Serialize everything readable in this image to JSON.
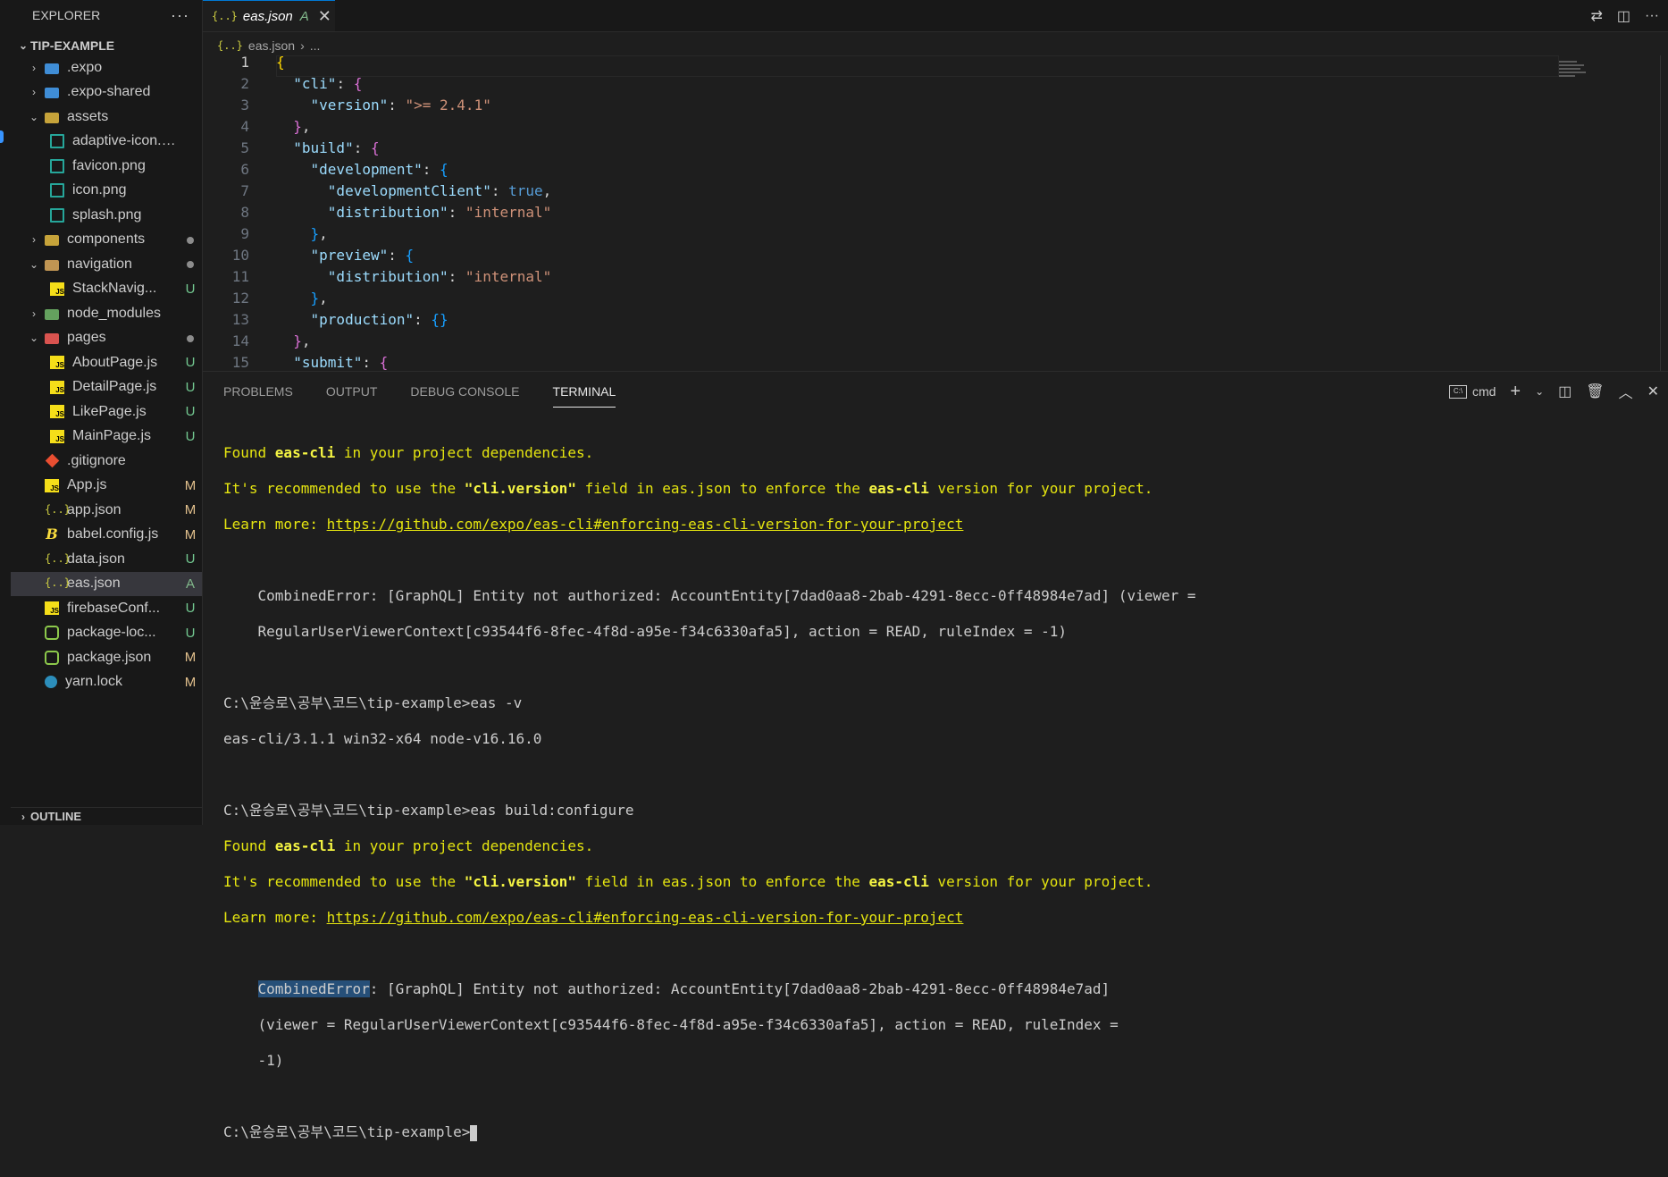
{
  "explorer": {
    "title": "EXPLORER",
    "more": "···",
    "project": "TIP-EXAMPLE",
    "items": [
      {
        "name": ".expo",
        "chev": "›",
        "icon": "folder-expo-icon",
        "badge": ""
      },
      {
        "name": ".expo-shared",
        "chev": "›",
        "icon": "folder-expo-icon",
        "badge": ""
      },
      {
        "name": "assets",
        "chev": "⌄",
        "icon": "folder-assets-icon",
        "badge": ""
      },
      {
        "name": "adaptive-icon.png",
        "icon": "image-file-icon",
        "badge": ""
      },
      {
        "name": "favicon.png",
        "icon": "image-file-icon",
        "badge": ""
      },
      {
        "name": "icon.png",
        "icon": "image-file-icon",
        "badge": ""
      },
      {
        "name": "splash.png",
        "icon": "image-file-icon",
        "badge": ""
      },
      {
        "name": "components",
        "chev": "›",
        "icon": "folder-components-icon",
        "badge": "dot"
      },
      {
        "name": "navigation",
        "chev": "⌄",
        "icon": "folder-icon",
        "badge": "dot"
      },
      {
        "name": "StackNavig...",
        "icon": "js-file-icon",
        "badge": "U"
      },
      {
        "name": "node_modules",
        "chev": "›",
        "icon": "folder-node-icon",
        "badge": ""
      },
      {
        "name": "pages",
        "chev": "⌄",
        "icon": "folder-pages-icon",
        "badge": "dot"
      },
      {
        "name": "AboutPage.js",
        "icon": "js-file-icon",
        "badge": "U"
      },
      {
        "name": "DetailPage.js",
        "icon": "js-file-icon",
        "badge": "U"
      },
      {
        "name": "LikePage.js",
        "icon": "js-file-icon",
        "badge": "U"
      },
      {
        "name": "MainPage.js",
        "icon": "js-file-icon",
        "badge": "U"
      },
      {
        "name": ".gitignore",
        "icon": "git-file-icon",
        "badge": ""
      },
      {
        "name": "App.js",
        "icon": "js-file-icon",
        "badge": "M"
      },
      {
        "name": "app.json",
        "icon": "json-file-icon",
        "badge": "M"
      },
      {
        "name": "babel.config.js",
        "icon": "babel-file-icon",
        "badge": "M"
      },
      {
        "name": "data.json",
        "icon": "json-file-icon",
        "badge": "U"
      },
      {
        "name": "eas.json",
        "icon": "json-file-icon",
        "badge": "A"
      },
      {
        "name": "firebaseConf...",
        "icon": "js-file-icon",
        "badge": "U"
      },
      {
        "name": "package-loc...",
        "icon": "node-file-icon",
        "badge": "U"
      },
      {
        "name": "package.json",
        "icon": "node-file-icon",
        "badge": "M"
      },
      {
        "name": "yarn.lock",
        "icon": "yarn-file-icon",
        "badge": "M"
      }
    ],
    "outline": "OUTLINE"
  },
  "tab": {
    "icon": "{..}",
    "name": "eas.json",
    "badge": "A",
    "close": "✕"
  },
  "breadcrumb": {
    "icon": "{..}",
    "file": "eas.json",
    "sep": "›",
    "rest": "..."
  },
  "editor": {
    "line_numbers": [
      "1",
      "2",
      "3",
      "4",
      "5",
      "6",
      "7",
      "8",
      "9",
      "10",
      "11",
      "12",
      "13",
      "14",
      "15"
    ]
  },
  "panel": {
    "tabs": [
      "PROBLEMS",
      "OUTPUT",
      "DEBUG CONSOLE",
      "TERMINAL"
    ],
    "shell": "cmd",
    "shell_icon": "C:\\",
    "terminal": {
      "found1a": "Found ",
      "found1b": "eas-cli",
      "found1c": " in your project dependencies.",
      "rec1a": "It's recommended to use the ",
      "rec1b": "\"cli.version\"",
      "rec1c": " field in eas.json to enforce the ",
      "rec1d": "eas-cli",
      "rec1e": " version for your project.",
      "learn1a": "Learn more: ",
      "learn1b": "https://github.com/expo/eas-cli#enforcing-eas-cli-version-for-your-project",
      "err1a": "    CombinedError: [GraphQL] Entity not authorized: AccountEntity[7dad0aa8-2bab-4291-8ecc-0ff48984e7ad] (viewer =",
      "err1b": "    RegularUserViewerContext[c93544f6-8fec-4f8d-a95e-f34c6330afa5], action = READ, ruleIndex = -1)",
      "cmd1": "C:\\윤승로\\공부\\코드\\tip-example>eas -v",
      "ver": "eas-cli/3.1.1 win32-x64 node-v16.16.0",
      "cmd2": "C:\\윤승로\\공부\\코드\\tip-example>eas build:configure",
      "err2sel": "CombinedError",
      "err2a": ": [GraphQL] Entity not authorized: AccountEntity[7dad0aa8-2bab-4291-8ecc-0ff48984e7ad]",
      "err2b": "    (viewer = RegularUserViewerContext[c93544f6-8fec-4f8d-a95e-f34c6330afa5], action = READ, ruleIndex =",
      "err2c": "    -1)",
      "prompt": "C:\\윤승로\\공부\\코드\\tip-example>"
    }
  },
  "colors": {
    "accent": "#0078d4",
    "untracked": "#73c991",
    "modified": "#e2c08d",
    "terminal_yellow": "#e5e510"
  }
}
